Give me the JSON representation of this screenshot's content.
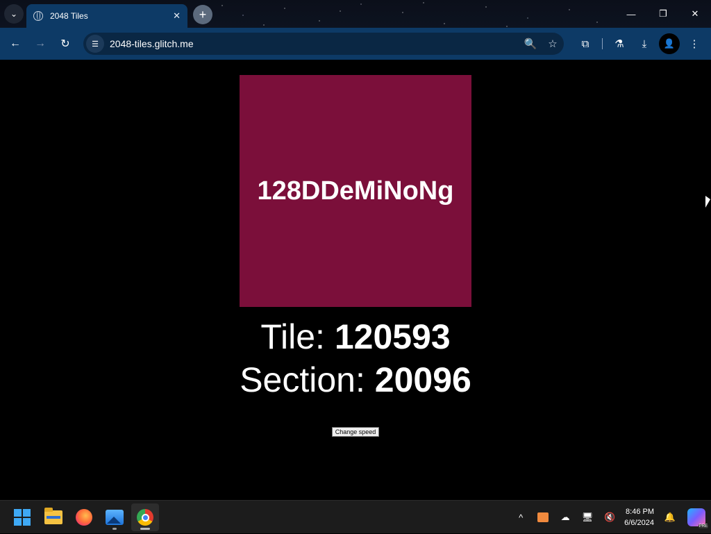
{
  "browser": {
    "tab_title": "2048 Tiles",
    "tab_close": "✕",
    "new_tab": "+",
    "url": "2048-tiles.glitch.me",
    "window_controls": {
      "minimize": "—",
      "restore": "❐",
      "close": "✕"
    }
  },
  "page": {
    "tile_label": "128DDeMiNoNg",
    "tile_color": "#7b0f3a",
    "tile_prefix": "Tile:",
    "tile_value": "120593",
    "section_prefix": "Section:",
    "section_value": "20096",
    "change_speed_label": "Change speed"
  },
  "taskbar": {
    "time": "8:46 PM",
    "date": "6/6/2024",
    "pre_badge": "PRE"
  },
  "icons": {
    "tab_menu": "⌄",
    "back": "←",
    "forward": "→",
    "reload": "↻",
    "site_info": "☰",
    "zoom": "🔍",
    "bookmark": "☆",
    "extensions": "⧉",
    "labs": "⚗",
    "download": "⤓",
    "profile": "👤",
    "menu": "⋮",
    "tray_chevron": "^",
    "cloud": "☁",
    "network": "🖥",
    "volume": "🔇",
    "bell": "🔔"
  }
}
